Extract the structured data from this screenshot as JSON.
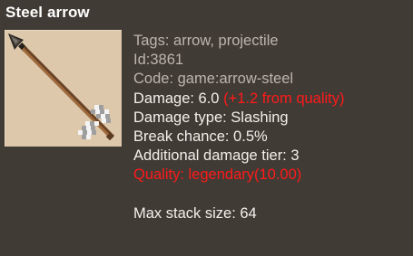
{
  "item": {
    "title": "Steel arrow",
    "icon": "steel-arrow-icon",
    "lines": {
      "tags": "Tags: arrow, projectile",
      "id": "Id:3861",
      "code": "Code: game:arrow-steel",
      "damage": "Damage: 6.0",
      "damage_bonus": "(+1.2 from quality)",
      "damage_type": "Damage type: Slashing",
      "break_chance": "Break chance: 0.5%",
      "damage_tier": "Additional damage tier: 3",
      "quality": "Quality: legendary(10.00)",
      "max_stack": "Max stack size: 64"
    }
  },
  "colors": {
    "background": "#403b35",
    "slot": "#ddc8ac",
    "text": "#f3f0ea",
    "muted_text": "#bcb5ac",
    "highlight_red": "#ff1a1a"
  }
}
